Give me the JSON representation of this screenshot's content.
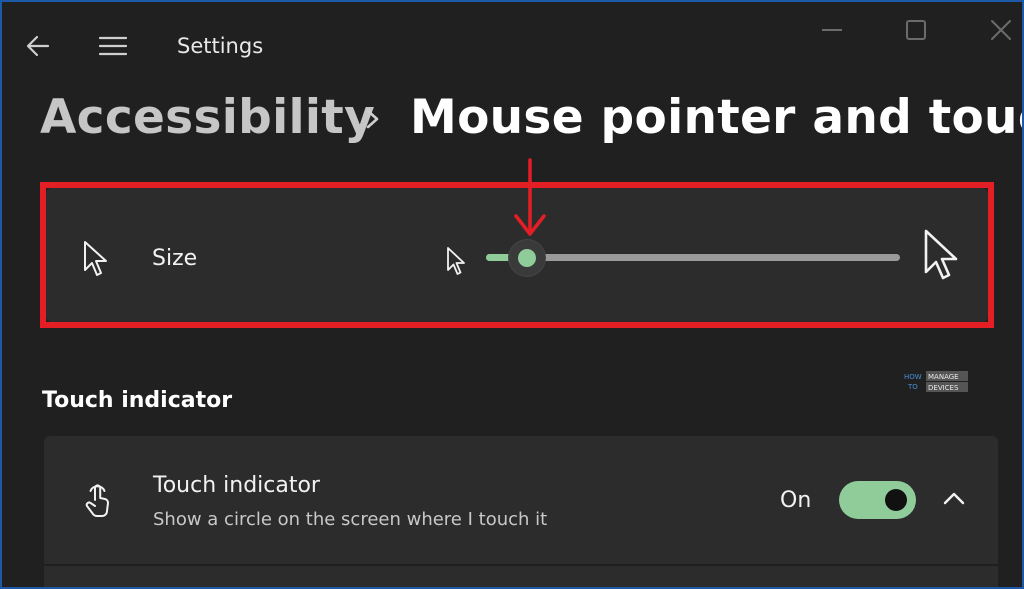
{
  "window": {
    "title": "Settings"
  },
  "breadcrumb": {
    "parent": "Accessibility",
    "current": "Mouse pointer and touch"
  },
  "size_setting": {
    "label": "Size",
    "slider_value_fraction": 0.1
  },
  "touch_section": {
    "heading": "Touch indicator",
    "item": {
      "title": "Touch indicator",
      "description": "Show a circle on the screen where I touch it",
      "state_label": "On",
      "enabled": true
    }
  },
  "watermark": {
    "lines": [
      "HOW",
      "TO",
      "MANAGE",
      "DEVICES"
    ]
  },
  "icons": {
    "back": "back-arrow-icon",
    "menu": "hamburger-menu-icon",
    "minimize": "minimize-icon",
    "maximize": "maximize-icon",
    "close": "close-icon",
    "size": "mouse-pointer-icon",
    "touch": "touch-hand-icon",
    "expand": "chevron-up-icon"
  },
  "colors": {
    "accent": "#8fcc9a",
    "highlight": "#e31e24",
    "background": "#202020",
    "card": "#2c2c2c"
  }
}
